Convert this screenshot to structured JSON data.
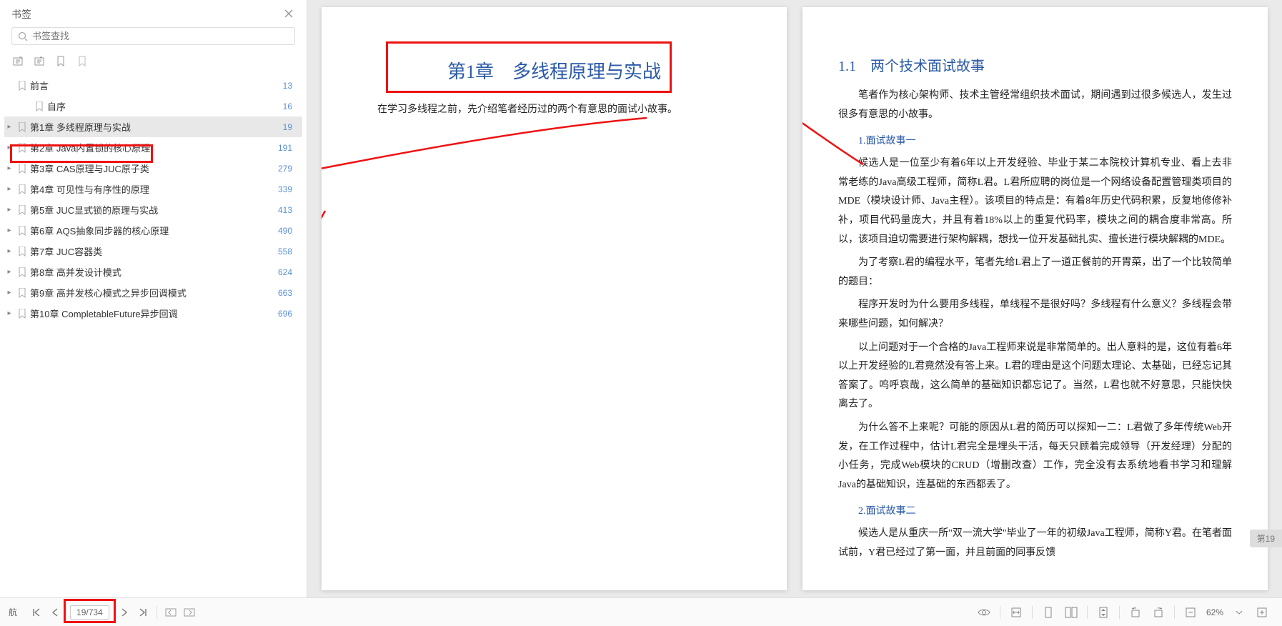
{
  "sidebar": {
    "title": "书签",
    "search_placeholder": "书签查找",
    "items": [
      {
        "label": "前言",
        "page": "13",
        "has_children": false,
        "indent": 0
      },
      {
        "label": "自序",
        "page": "16",
        "has_children": false,
        "indent": 1
      },
      {
        "label": "第1章 多线程原理与实战",
        "page": "19",
        "has_children": true,
        "indent": 0,
        "active": true
      },
      {
        "label": "第2章 Java内置锁的核心原理",
        "page": "191",
        "has_children": true,
        "indent": 0
      },
      {
        "label": "第3章 CAS原理与JUC原子类",
        "page": "279",
        "has_children": true,
        "indent": 0
      },
      {
        "label": "第4章 可见性与有序性的原理",
        "page": "339",
        "has_children": true,
        "indent": 0
      },
      {
        "label": "第5章 JUC显式锁的原理与实战",
        "page": "413",
        "has_children": true,
        "indent": 0
      },
      {
        "label": "第6章 AQS抽象同步器的核心原理",
        "page": "490",
        "has_children": true,
        "indent": 0
      },
      {
        "label": "第7章 JUC容器类",
        "page": "558",
        "has_children": true,
        "indent": 0
      },
      {
        "label": "第8章 高并发设计模式",
        "page": "624",
        "has_children": true,
        "indent": 0
      },
      {
        "label": "第9章 高并发核心模式之异步回调模式",
        "page": "663",
        "has_children": true,
        "indent": 0
      },
      {
        "label": "第10章 CompletableFuture异步回调",
        "page": "696",
        "has_children": true,
        "indent": 0
      }
    ]
  },
  "page_left": {
    "chapter_title": "第1章　多线程原理与实战",
    "intro": "在学习多线程之前，先介绍笔者经历过的两个有意思的面试小故事。"
  },
  "page_right": {
    "section_title": "1.1　两个技术面试故事",
    "p1": "笔者作为核心架构师、技术主管经常组织技术面试，期间遇到过很多候选人，发生过很多有意思的小故事。",
    "sub1": "1.面试故事一",
    "p2": "候选人是一位至少有着6年以上开发经验、毕业于某二本院校计算机专业、看上去非常老练的Java高级工程师，简称L君。L君所应聘的岗位是一个网络设备配置管理类项目的MDE（模块设计师、Java主程）。该项目的特点是：有着8年历史代码积累，反复地修修补补，项目代码量庞大，并且有着18%以上的重复代码率，模块之间的耦合度非常高。所以，该项目迫切需要进行架构解耦，想找一位开发基础扎实、擅长进行模块解耦的MDE。",
    "p3": "为了考察L君的编程水平，笔者先给L君上了一道正餐前的开胃菜，出了一个比较简单的题目：",
    "p4": "程序开发时为什么要用多线程，单线程不是很好吗？多线程有什么意义？多线程会带来哪些问题，如何解决？",
    "p5": "以上问题对于一个合格的Java工程师来说是非常简单的。出人意料的是，这位有着6年以上开发经验的L君竟然没有答上来。L君的理由是这个问题太理论、太基础，已经忘记其答案了。呜呼哀哉，这么简单的基础知识都忘记了。当然，L君也就不好意思，只能快快离去了。",
    "p6": "为什么答不上来呢？可能的原因从L君的简历可以探知一二：L君做了多年传统Web开发，在工作过程中，估计L君完全是埋头干活，每天只顾着完成领导（开发经理）分配的小任务，完成Web模块的CRUD（增删改查）工作，完全没有去系统地看书学习和理解Java的基础知识，连基础的东西都丢了。",
    "sub2": "2.面试故事二",
    "p7": "候选人是从重庆一所\"双一流大学\"毕业了一年的初级Java工程师，简称Y君。在笔者面试前，Y君已经过了第一面，并且前面的同事反馈"
  },
  "bottom": {
    "nav_label": "航",
    "page_indicator": "19/734",
    "zoom": "62%",
    "corner_badge": "第19"
  }
}
